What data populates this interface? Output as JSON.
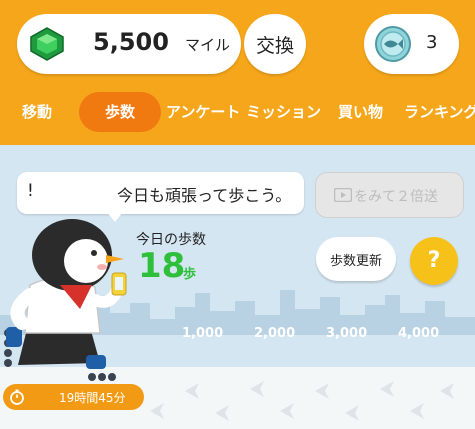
{
  "header": {
    "miles_value": "5,500",
    "miles_unit": "マイル",
    "exchange_label": "交換",
    "coin_count": "3"
  },
  "tabs": [
    {
      "label": "移動"
    },
    {
      "label": "歩数"
    },
    {
      "label": "アンケート"
    },
    {
      "label": "ミッション"
    },
    {
      "label": "買い物"
    },
    {
      "label": "ランキング"
    }
  ],
  "speech": {
    "exclaim": "!",
    "text": "今日も頑張って歩こう。"
  },
  "watch_ad": {
    "label": "をみて２倍送"
  },
  "steps": {
    "title": "今日の歩数",
    "value": "18",
    "unit": "歩",
    "multiplier": "×2"
  },
  "buttons": {
    "update": "歩数更新",
    "help": "?"
  },
  "progress": {
    "ticks": [
      "1,000",
      "2,000",
      "3,000",
      "4,000"
    ],
    "current_steps": 18
  },
  "timer": {
    "text": "19時間45分"
  },
  "colors": {
    "header_orange": "#f6a61a",
    "active_tab": "#f07a10",
    "steps_green": "#2fbf3a",
    "help_yellow": "#f6c21a"
  },
  "icons": {
    "gem": "emerald-gem-icon",
    "coin": "fish-coin-icon",
    "ad": "video-play-icon",
    "timer": "stopwatch-icon"
  }
}
